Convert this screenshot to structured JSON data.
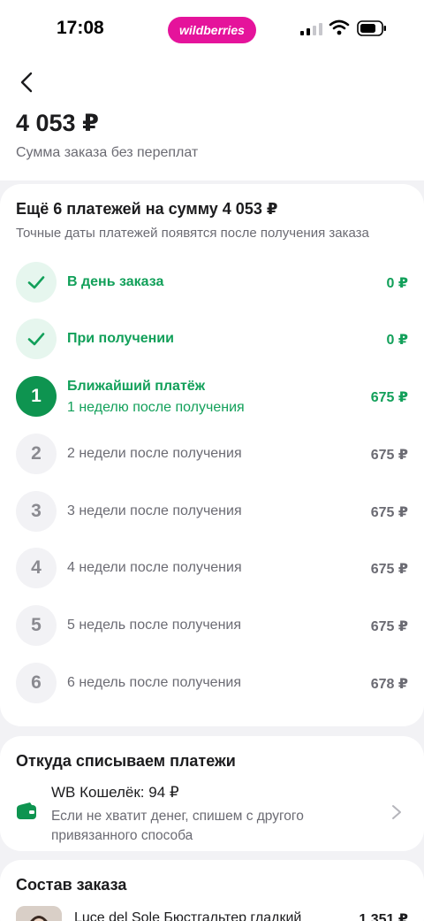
{
  "status_bar": {
    "time": "17:08",
    "brand": "wildberries"
  },
  "header": {
    "total": "4 053 ₽",
    "caption": "Сумма заказа без переплат"
  },
  "payments": {
    "title": "Ещё 6 платежей на сумму 4 053 ₽",
    "subtitle": "Точные даты платежей появятся после получения заказа",
    "rows": [
      {
        "marker": "",
        "label": "В день заказа",
        "sub": "",
        "amount": "0 ₽",
        "state": "done"
      },
      {
        "marker": "",
        "label": "При получении",
        "sub": "",
        "amount": "0 ₽",
        "state": "done"
      },
      {
        "marker": "1",
        "label": "Ближайший платёж",
        "sub": "1 неделю после получения",
        "amount": "675 ₽",
        "state": "current"
      },
      {
        "marker": "2",
        "label": "2 недели после получения",
        "sub": "",
        "amount": "675 ₽",
        "state": "pending"
      },
      {
        "marker": "3",
        "label": "3 недели после получения",
        "sub": "",
        "amount": "675 ₽",
        "state": "pending"
      },
      {
        "marker": "4",
        "label": "4 недели после получения",
        "sub": "",
        "amount": "675 ₽",
        "state": "pending"
      },
      {
        "marker": "5",
        "label": "5 недель после получения",
        "sub": "",
        "amount": "675 ₽",
        "state": "pending"
      },
      {
        "marker": "6",
        "label": "6 недель после получения",
        "sub": "",
        "amount": "678 ₽",
        "state": "pending"
      }
    ]
  },
  "source": {
    "title": "Откуда списываем платежи",
    "wallet_title": "WB Кошелёк: 94 ₽",
    "wallet_note": "Если не хватит денег, спишем с другого привязанного способа"
  },
  "order": {
    "title": "Состав заказа",
    "product_name": "Luce del Sole  Бюстгальтер гладкий",
    "product_price": "1 351 ₽"
  },
  "colors": {
    "accent_green": "#12a05a",
    "brand_pink": "#e5139b"
  }
}
